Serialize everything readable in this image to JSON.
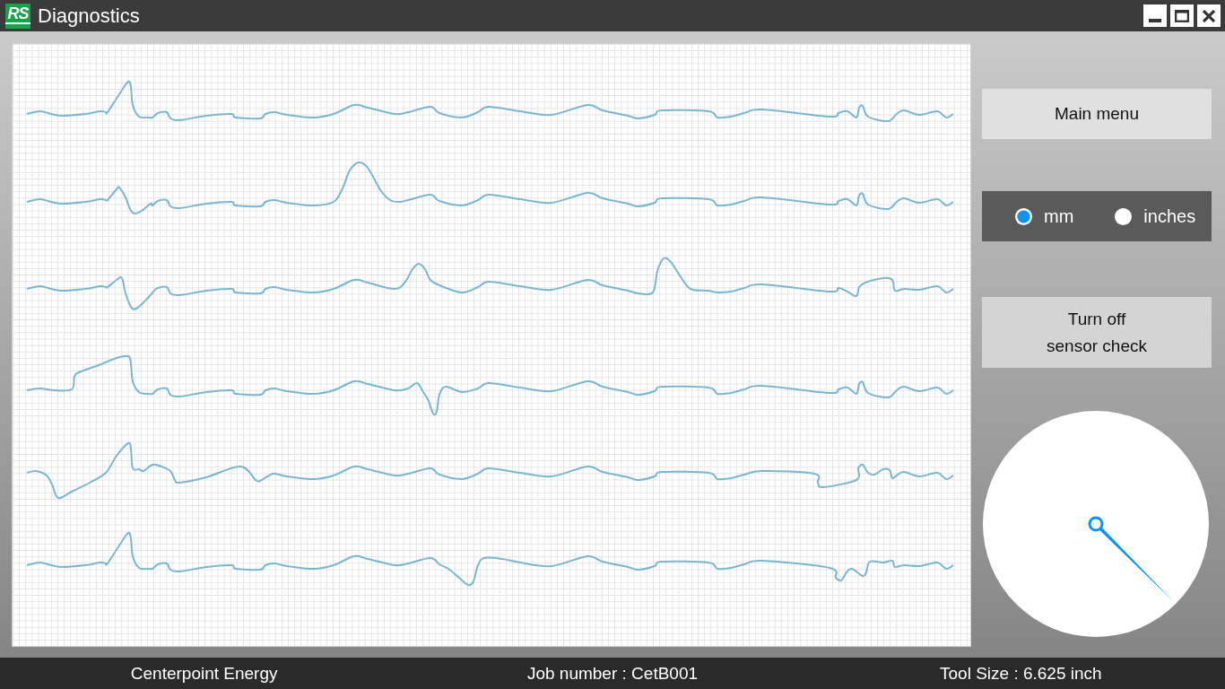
{
  "window": {
    "logo": "RS",
    "title": "Diagnostics"
  },
  "main_menu_button": {
    "label": "Main menu"
  },
  "unit_selector": {
    "options": [
      {
        "label": "mm",
        "selected": true
      },
      {
        "label": "inches",
        "selected": false
      }
    ]
  },
  "sensor_check_button": {
    "label": "Turn off\nsensor check"
  },
  "status_bar": [
    "Centerpoint Energy",
    "Job number : CetB001",
    "Tool Size : 6.625 inch"
  ]
}
